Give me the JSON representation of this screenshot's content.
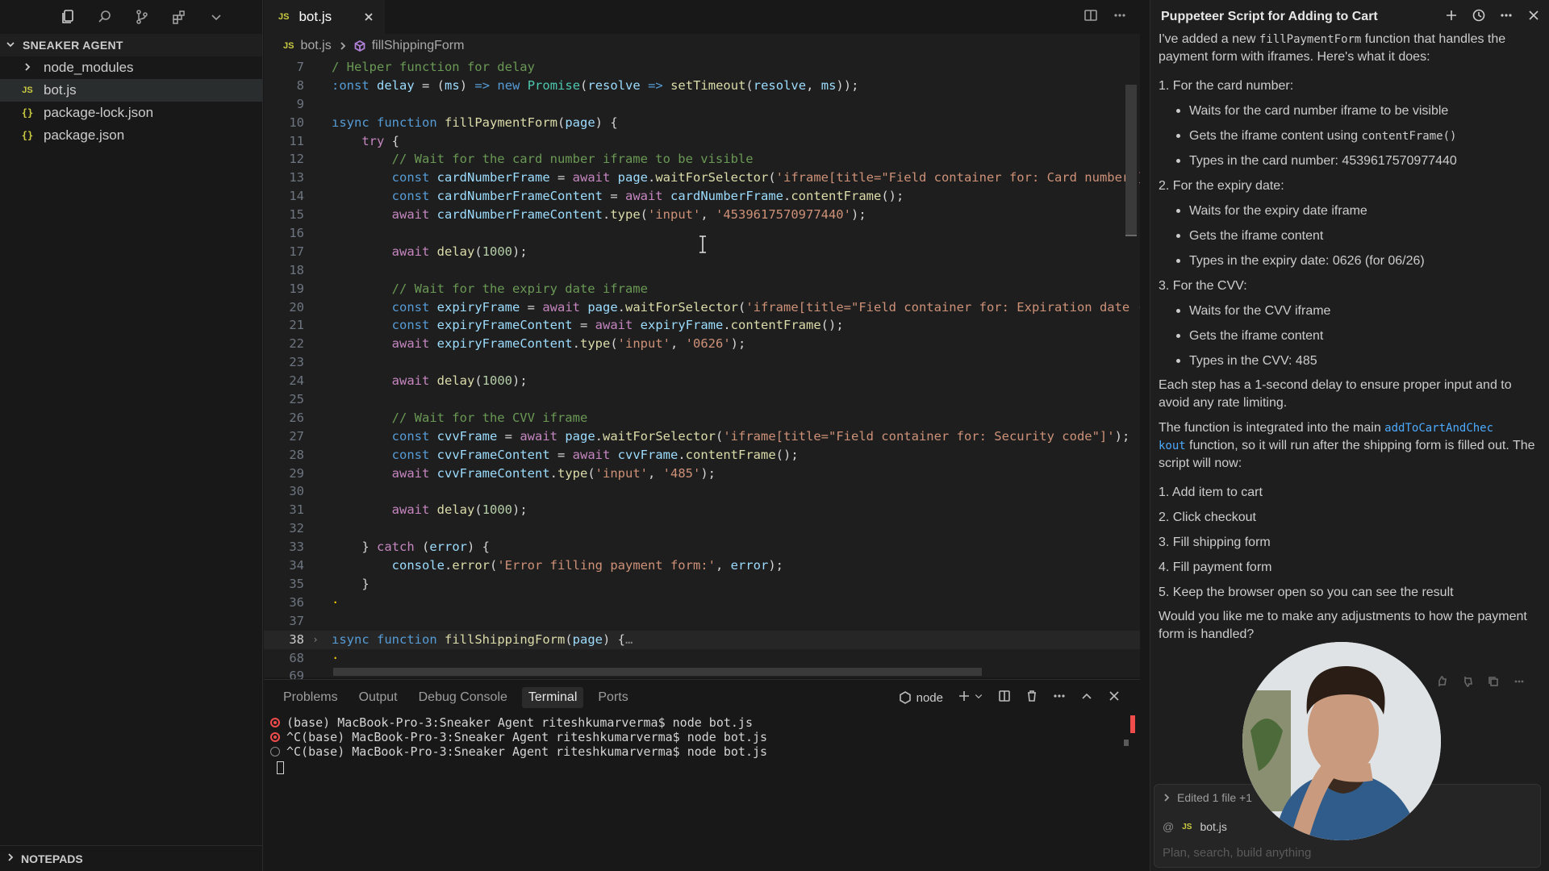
{
  "sidebar": {
    "section_title": "SNEAKER AGENT",
    "files": [
      {
        "name": "node_modules",
        "type": "folder"
      },
      {
        "name": "bot.js",
        "type": "js"
      },
      {
        "name": "package-lock.json",
        "type": "json"
      },
      {
        "name": "package.json",
        "type": "json"
      }
    ],
    "notepads": "NOTEPADS"
  },
  "editor": {
    "tab_label": "bot.js",
    "tab_icon": "JS",
    "breadcrumb_file": "bot.js",
    "breadcrumb_symbol": "fillShippingForm",
    "line_numbers": [
      "7",
      "8",
      "9",
      "10",
      "11",
      "12",
      "13",
      "14",
      "15",
      "16",
      "17",
      "18",
      "19",
      "20",
      "21",
      "22",
      "23",
      "24",
      "25",
      "26",
      "27",
      "28",
      "29",
      "30",
      "31",
      "32",
      "33",
      "34",
      "35",
      "36",
      "37",
      "38",
      "68",
      "69"
    ]
  },
  "panel": {
    "tabs": [
      "Problems",
      "Output",
      "Debug Console",
      "Terminal",
      "Ports"
    ],
    "active_tab": "Terminal",
    "shell_label": "node",
    "terminal_lines": [
      "(base) MacBook-Pro-3:Sneaker Agent riteshkumarverma$ node bot.js",
      "^C(base) MacBook-Pro-3:Sneaker Agent riteshkumarverma$ node bot.js",
      "^C(base) MacBook-Pro-3:Sneaker Agent riteshkumarverma$ node bot.js"
    ]
  },
  "chat": {
    "title": "Puppeteer Script for Adding to Cart",
    "intro_a": "I've added a new ",
    "intro_code": "fillPaymentForm",
    "intro_b": " function that handles the payment form with iframes. Here's what it does:",
    "step1": "1. For the card number:",
    "step1_items": [
      "Waits for the card number iframe to be visible",
      "Gets the iframe content using ",
      "Types in the card number: 4539617570977440"
    ],
    "step1_code": "contentFrame()",
    "step2": "2. For the expiry date:",
    "step2_items": [
      "Waits for the expiry date iframe",
      "Gets the iframe content",
      "Types in the expiry date: 0626 (for 06/26)"
    ],
    "step3": "3. For the CVV:",
    "step3_items": [
      "Waits for the CVV iframe",
      "Gets the iframe content",
      "Types in the CVV: 485"
    ],
    "delay_note": "Each step has a 1-second delay to ensure proper input and to avoid any rate limiting.",
    "integrated_a": "The function is integrated into the main ",
    "integrated_link_1": "addToCartAndChec",
    "integrated_link_2": "kout",
    "integrated_b": " function, so it will run after the shipping form is filled out. The script will now:",
    "flow": [
      "1. Add item to cart",
      "2. Click checkout",
      "3. Fill shipping form",
      "4. Fill payment form",
      "5. Keep the browser open so you can see the result"
    ],
    "question": "Would you like me to make any adjustments to how the payment form is handled?",
    "edited": "Edited 1 file +1",
    "context_file": "bot.js",
    "input_placeholder": "Plan, search, build anything"
  },
  "colors": {
    "keyword": "#569cd6",
    "control": "#c586c0",
    "function": "#dcdcaa",
    "string": "#ce9178",
    "number": "#b5cea8",
    "comment": "#6a9955",
    "link": "#4daafc",
    "error": "#f14c4c"
  }
}
